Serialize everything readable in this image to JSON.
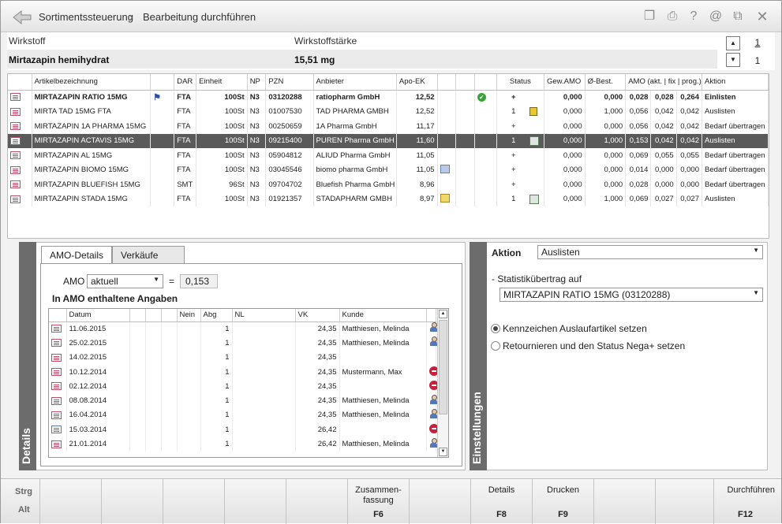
{
  "titlebar": {
    "breadcrumb": [
      "Sortimentssteuerung",
      "Bearbeitung durchführen"
    ],
    "icons": [
      "copy-icon",
      "print-icon",
      "help-icon",
      "at-icon",
      "window-icon",
      "close-icon"
    ]
  },
  "substance": {
    "label_wirkstoff": "Wirkstoff",
    "label_staerke": "Wirkstoffstärke",
    "wirkstoff": "Mirtazapin hemihydrat",
    "staerke": "15,51 mg",
    "page1": "1",
    "page2": "1"
  },
  "articles": {
    "headers": [
      "Artikelbezeichnung",
      "DAR",
      "Einheit",
      "NP",
      "PZN",
      "Anbieter",
      "Apo-EK",
      "Status",
      "Gew.AMO",
      "Ø-Best.",
      "AMO (akt. | fix | prog.)",
      "Aktion"
    ],
    "rows": [
      {
        "name": "MIRTAZAPIN RATIO 15MG",
        "dar": "FTA",
        "einheit": "100St",
        "np": "N3",
        "pzn": "03120288",
        "anbieter": "ratiopharm GmbH",
        "apoek": "12,52",
        "status": "+",
        "gew": "0,000",
        "best": "0,000",
        "akt": "0,028",
        "fix": "0,028",
        "prog": "0,264",
        "aktion": "Einlisten"
      },
      {
        "name": "MIRTA TAD 15MG FTA",
        "dar": "FTA",
        "einheit": "100St",
        "np": "N3",
        "pzn": "01007530",
        "anbieter": "TAD PHARMA GMBH",
        "apoek": "12,52",
        "status": "1",
        "gew": "0,000",
        "best": "1,000",
        "akt": "0,056",
        "fix": "0,042",
        "prog": "0,042",
        "aktion": "Auslisten"
      },
      {
        "name": "MIRTAZAPIN 1A PHARMA 15MG",
        "dar": "FTA",
        "einheit": "100St",
        "np": "N3",
        "pzn": "00250659",
        "anbieter": "1A Pharma GmbH",
        "apoek": "11,17",
        "status": "+",
        "gew": "0,000",
        "best": "0,000",
        "akt": "0,056",
        "fix": "0,042",
        "prog": "0,042",
        "aktion": "Bedarf übertragen"
      },
      {
        "name": "MIRTAZAPIN ACTAVIS 15MG",
        "dar": "FTA",
        "einheit": "100St",
        "np": "N3",
        "pzn": "09215400",
        "anbieter": "PUREN Pharma GmbH",
        "apoek": "11,60",
        "status": "1",
        "gew": "0,000",
        "best": "1,000",
        "akt": "0,153",
        "fix": "0,042",
        "prog": "0,042",
        "aktion": "Auslisten"
      },
      {
        "name": "MIRTAZAPIN AL 15MG",
        "dar": "FTA",
        "einheit": "100St",
        "np": "N3",
        "pzn": "05904812",
        "anbieter": "ALIUD Pharma GmbH",
        "apoek": "11,05",
        "status": "+",
        "gew": "0,000",
        "best": "0,000",
        "akt": "0,069",
        "fix": "0,055",
        "prog": "0,055",
        "aktion": "Bedarf übertragen"
      },
      {
        "name": "MIRTAZAPIN BIOMO 15MG",
        "dar": "FTA",
        "einheit": "100St",
        "np": "N3",
        "pzn": "03045546",
        "anbieter": "biomo pharma GmbH",
        "apoek": "11,05",
        "status": "+",
        "gew": "0,000",
        "best": "0,000",
        "akt": "0,014",
        "fix": "0,000",
        "prog": "0,000",
        "aktion": "Bedarf übertragen"
      },
      {
        "name": "MIRTAZAPIN BLUEFISH 15MG",
        "dar": "SMT",
        "einheit": "96St",
        "np": "N3",
        "pzn": "09704702",
        "anbieter": "Bluefish Pharma GmbH",
        "apoek": "8,96",
        "status": "+",
        "gew": "0,000",
        "best": "0,000",
        "akt": "0,028",
        "fix": "0,000",
        "prog": "0,000",
        "aktion": "Bedarf übertragen"
      },
      {
        "name": "MIRTAZAPIN STADA 15MG",
        "dar": "FTA",
        "einheit": "100St",
        "np": "N3",
        "pzn": "01921357",
        "anbieter": "STADAPHARM GMBH",
        "apoek": "8,97",
        "status": "1",
        "gew": "0,000",
        "best": "1,000",
        "akt": "0,069",
        "fix": "0,027",
        "prog": "0,027",
        "aktion": "Auslisten"
      }
    ]
  },
  "details": {
    "side_label": "Details",
    "tabs": [
      "AMO-Details",
      "Verkäufe"
    ],
    "amo_label": "AMO",
    "amo_select": "aktuell",
    "equals": "=",
    "amo_value": "0,153",
    "section_title": "In AMO enthaltene Angaben",
    "sales_headers": [
      "Datum",
      "Nein",
      "Abg",
      "NL",
      "VK",
      "Kunde"
    ],
    "sales": [
      {
        "datum": "11.06.2015",
        "abg": "1",
        "vk": "24,35",
        "kunde": "Matthiesen, Melinda",
        "icon": "person"
      },
      {
        "datum": "25.02.2015",
        "abg": "1",
        "vk": "24,35",
        "kunde": "Matthiesen, Melinda",
        "icon": "person"
      },
      {
        "datum": "14.02.2015",
        "abg": "1",
        "vk": "24,35",
        "kunde": "",
        "icon": ""
      },
      {
        "datum": "10.12.2014",
        "abg": "1",
        "vk": "24,35",
        "kunde": "Mustermann, Max",
        "icon": "nega"
      },
      {
        "datum": "02.12.2014",
        "abg": "1",
        "vk": "24,35",
        "kunde": "",
        "icon": "nega"
      },
      {
        "datum": "08.08.2014",
        "abg": "1",
        "vk": "24,35",
        "kunde": "Matthiesen, Melinda",
        "icon": "person"
      },
      {
        "datum": "16.04.2014",
        "abg": "1",
        "vk": "24,35",
        "kunde": "Matthiesen, Melinda",
        "icon": "person"
      },
      {
        "datum": "15.03.2014",
        "abg": "1",
        "vk": "26,42",
        "kunde": "",
        "icon": "nega"
      },
      {
        "datum": "21.01.2014",
        "abg": "1",
        "vk": "26,42",
        "kunde": "Matthiesen, Melinda",
        "icon": "person"
      }
    ]
  },
  "settings": {
    "side_label": "Einstellungen",
    "aktion_label": "Aktion",
    "aktion_value": "Auslisten",
    "statistik_label": "- Statistikübertrag auf",
    "statistik_value": "MIRTAZAPIN RATIO 15MG (03120288)",
    "radio1": "Kennzeichen Auslaufartikel setzen",
    "radio2": "Retournieren und den Status Nega+ setzen"
  },
  "fkeys": {
    "strg": "Strg",
    "alt": "Alt",
    "f6_label1": "Zusammen-",
    "f6_label2": "fassung",
    "f6": "F6",
    "f8_label": "Details",
    "f8": "F8",
    "f9_label": "Drucken",
    "f9": "F9",
    "f12_label": "Durchführen",
    "f12": "F12"
  }
}
